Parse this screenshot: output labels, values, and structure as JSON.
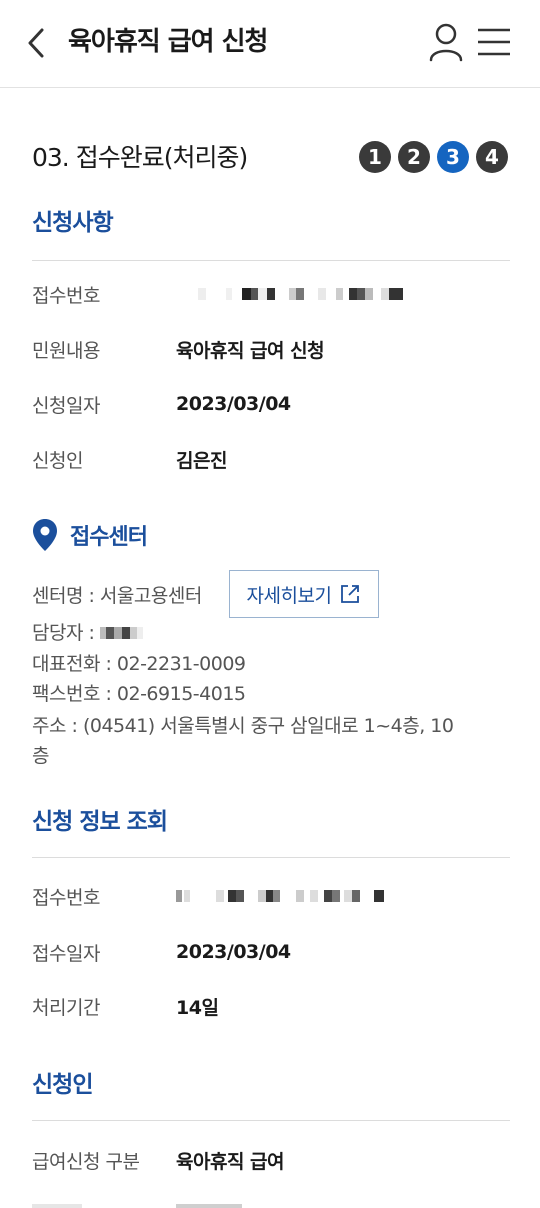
{
  "header": {
    "title": "육아휴직 급여 신청",
    "back_icon": "chevron-left-icon",
    "user_icon": "user-icon",
    "menu_icon": "hamburger-menu-icon"
  },
  "progress": {
    "title": "03. 접수완료(처리중)",
    "steps": [
      "1",
      "2",
      "3",
      "4"
    ],
    "current_step": 3,
    "colors": {
      "active": "#1565c0",
      "inactive": "#3a3a3a"
    }
  },
  "application": {
    "title": "신청사항",
    "rows": [
      {
        "label": "접수번호",
        "value": ""
      },
      {
        "label": "민원내용",
        "value": "육아휴직 급여 신청"
      },
      {
        "label": "신청일자",
        "value": "2023/03/04"
      },
      {
        "label": "신청인",
        "value": "김은진"
      }
    ]
  },
  "center": {
    "title": "접수센터",
    "icon": "location-pin-icon",
    "name_line": "센터명 : 서울고용센터",
    "detail_button": "자세히보기",
    "detail_icon": "external-link-icon",
    "manager_label": "담당자 :",
    "phone_line": "대표전화 : 02-2231-0009",
    "fax_line": "팩스번호 : 02-6915-4015",
    "address_line1": "주소 : (04541) 서울특별시 중구 삼일대로 1~4층, 10",
    "address_line2": "층"
  },
  "inquiry": {
    "title": "신청 정보 조회",
    "rows": [
      {
        "label": "접수번호",
        "value": ""
      },
      {
        "label": "접수일자",
        "value": "2023/03/04"
      },
      {
        "label": "처리기간",
        "value": "14일"
      }
    ]
  },
  "applicant": {
    "title": "신청인",
    "rows": [
      {
        "label": "급여신청 구분",
        "value": "육아휴직 급여"
      }
    ]
  },
  "colors": {
    "accent": "#1b4f9c",
    "divider": "#dcdcdc"
  }
}
